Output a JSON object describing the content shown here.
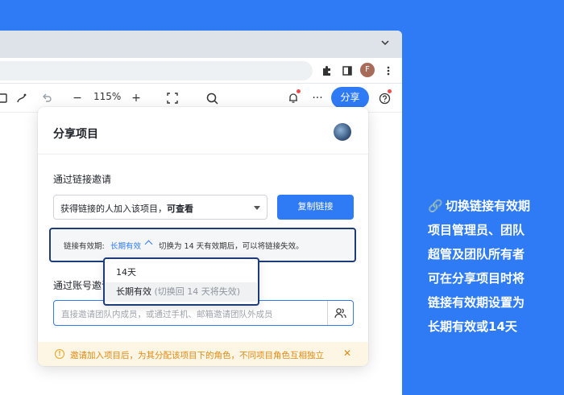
{
  "browser": {
    "profile_initial": "F"
  },
  "toolbar": {
    "zoom": "115%",
    "minus": "−",
    "plus": "+",
    "more": "···",
    "share_label": "分享"
  },
  "dialog": {
    "title": "分享项目",
    "link_section_label": "通过链接邀请",
    "permission": {
      "prefix": "获得链接的人加入该项目，",
      "access": "可查看"
    },
    "copy_button": "复制链接",
    "validity": {
      "label": "链接有效期:",
      "value": "长期有效",
      "hint": "切换为 14 天有效期后，可以将链接失效。"
    },
    "validity_options": [
      {
        "label": "14天",
        "sub": ""
      },
      {
        "label": "长期有效",
        "sub": "(切换回 14 天将失效)"
      }
    ],
    "account_section_label": "通过账号邀请",
    "invite_placeholder": "直接邀请团队内成员，或通过手机、邮箱邀请团队外成员",
    "notice": "邀请加入项目后，为其分配该项目下的角色，不同项目角色互相独立",
    "notice_icon_glyph": "!",
    "notice_close": "✕"
  },
  "caption": {
    "icon": "🔗",
    "lines": [
      "切换链接有效期",
      "项目管理员、团队",
      "超管及团队所有者",
      "可在分享项目时将",
      "链接有效期设置为",
      "长期有效或14天"
    ]
  },
  "colors": {
    "background": "#2f7bf6",
    "accent": "#2f7bf6",
    "highlight_border": "#1d3c78",
    "notice_bg": "#fdf6e4",
    "notice_text": "#e08a14"
  },
  "icons": [
    "chevron-down-icon",
    "puzzle-icon",
    "sidepanel-icon",
    "kebab-menu-icon",
    "frame-icon",
    "pen-curve-icon",
    "undo-icon",
    "fit-screen-icon",
    "search-icon",
    "bell-icon",
    "more-icon",
    "help-icon",
    "link-icon",
    "add-members-icon",
    "warning-icon",
    "close-icon"
  ]
}
